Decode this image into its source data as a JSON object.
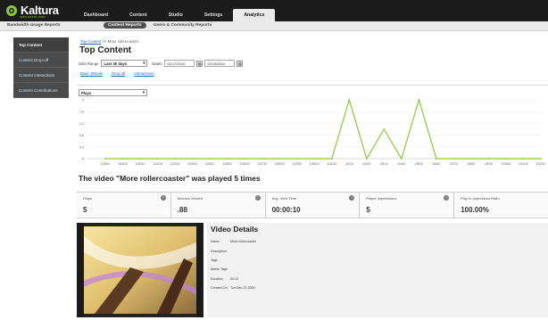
{
  "brand": {
    "name": "Kaltura",
    "tagline": "open source video"
  },
  "nav": {
    "items": [
      "Dashboard",
      "Content",
      "Studio",
      "Settings",
      "Analytics"
    ],
    "active": 4
  },
  "subnav": {
    "items": [
      "Bandwidth Usage Reports",
      "Content Reports",
      "Users & Community Reports"
    ],
    "active": 1
  },
  "sidebar": {
    "items": [
      "Top Content",
      "Content Drop-off",
      "Content Interactions",
      "Content Contributions"
    ],
    "active": 0
  },
  "breadcrumb": {
    "link": "Top Content",
    "separator": ">>",
    "current": "More rollercoaster"
  },
  "page": {
    "title": "Top Content"
  },
  "filters": {
    "date_range_label": "Date Range",
    "date_range_value": "Last 30 days",
    "dates_label": "Dates",
    "from": "01/17/2010",
    "to": "02/15/2010"
  },
  "links": [
    "Basic Details",
    "Drop-off",
    "Interactions"
  ],
  "chart_select": "Plays",
  "chart_data": {
    "type": "line",
    "x": [
      "1/18/10",
      "1/19/10",
      "1/20/10",
      "1/21/10",
      "1/22/10",
      "1/23/10",
      "1/24/10",
      "1/25/10",
      "1/26/10",
      "1/27/10",
      "1/28/10",
      "1/29/10",
      "1/30/10",
      "1/31/10",
      "2/1/10",
      "2/2/10",
      "2/3/10",
      "2/4/10",
      "2/5/10",
      "2/6/10",
      "2/7/10",
      "2/8/10",
      "2/9/10",
      "2/10/10",
      "2/11/10",
      "2/12/10"
    ],
    "series": [
      {
        "values": [
          0,
          0,
          0,
          0,
          0,
          0,
          0,
          0,
          0,
          0,
          0,
          0,
          0,
          0,
          2,
          0,
          1,
          0,
          2,
          0,
          0,
          0,
          0,
          0,
          0,
          0
        ]
      }
    ],
    "yticks": [
      "2",
      "1.6",
      "1.2",
      "0.8",
      "0.4",
      "0"
    ],
    "ylim": [
      0,
      2
    ],
    "color": "#8cc63f"
  },
  "headline": "The video \"More rollercoaster\"  was played 5 times",
  "metrics": [
    {
      "label": "Plays",
      "value": "5"
    },
    {
      "label": "Minutes Viewed",
      "value": ".88"
    },
    {
      "label": "Avg. View Time",
      "value": "00:00:10"
    },
    {
      "label": "Player Impressions",
      "value": "5"
    },
    {
      "label": "Play to Impression Ratio",
      "value": "100.00%"
    }
  ],
  "details": {
    "title": "Video Details",
    "rows": [
      {
        "k": "Name",
        "v": "More rollercoaster"
      },
      {
        "k": "Description",
        "v": ""
      },
      {
        "k": "Tags",
        "v": ""
      },
      {
        "k": "Admin Tags",
        "v": ""
      },
      {
        "k": "Duration",
        "v": "00:12"
      },
      {
        "k": "Created On",
        "v": "Tue Dec 22 2009"
      }
    ]
  }
}
